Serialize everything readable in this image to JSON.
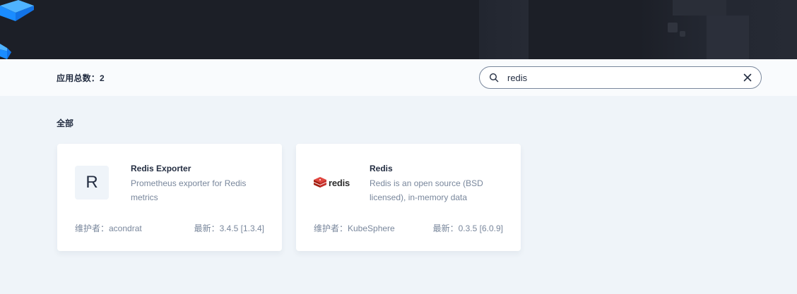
{
  "toolbar": {
    "total_label": "应用总数：2",
    "search": {
      "value": "redis",
      "placeholder": ""
    }
  },
  "section": {
    "title": "全部"
  },
  "apps": [
    {
      "icon_letter": "R",
      "name": "Redis Exporter",
      "description": "Prometheus exporter for Redis metrics",
      "maintainer": "维护者：acondrat",
      "latest": "最新：3.4.5 [1.3.4]"
    },
    {
      "icon_name": "redis-logo-icon",
      "logo_text": "redis",
      "name": "Redis",
      "description": "Redis is an open source (BSD licensed), in-memory data",
      "maintainer": "维护者：KubeSphere",
      "latest": "最新：0.3.5 [6.0.9]"
    }
  ],
  "colors": {
    "banner_bg": "#1c1f27",
    "page_bg": "#eff4f9",
    "text_primary": "#242e42",
    "text_secondary": "#79879c",
    "cube_blue": "#1a8cff",
    "redis_red": "#c6302b"
  }
}
